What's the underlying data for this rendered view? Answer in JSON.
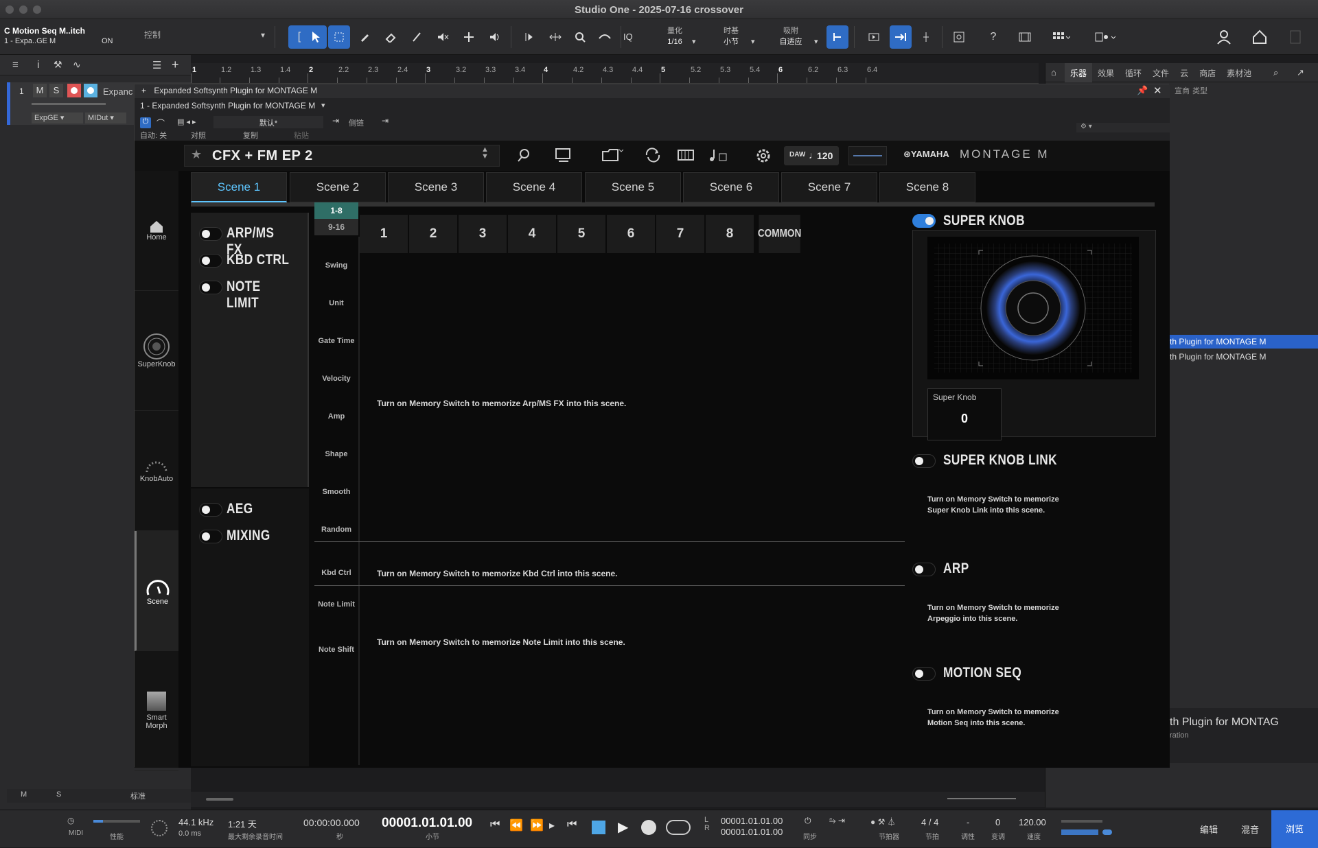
{
  "window": {
    "title": "Studio One - 2025-07-16 crossover"
  },
  "track_header": {
    "name": "C Motion Seq M..itch",
    "sub": "1 - Expa..GE M",
    "label": "控制",
    "on": "ON"
  },
  "toolbar": {
    "quantize_label": "量化",
    "quantize_value": "1/16",
    "timebase_label": "时基",
    "timebase_value": "小节",
    "snap_label": "吸附",
    "snap_value": "自适应",
    "iq": "IQ"
  },
  "ruler": {
    "marks": [
      "1",
      "1.2",
      "1.3",
      "1.4",
      "2",
      "2.2",
      "2.3",
      "2.4",
      "3",
      "3.2",
      "3.3",
      "3.4",
      "4",
      "4.2",
      "4.3",
      "4.4",
      "5",
      "5.2",
      "5.3",
      "5.4",
      "6",
      "6.2",
      "6.3",
      "6.4"
    ]
  },
  "track": {
    "number": "1",
    "m": "M",
    "s": "S",
    "name": "Expanc",
    "input": "ExpGE",
    "output": "MIDut"
  },
  "browser": {
    "tabs": [
      "乐器",
      "效果",
      "循环",
      "文件",
      "云",
      "商店",
      "素材池"
    ],
    "col_a": "宣商",
    "col_b": "类型",
    "items": [
      "th Plugin for MONTAGE M",
      "th Plugin for MONTAGE M"
    ],
    "footer_title": "th Plugin for MONTAG",
    "footer_sub": "ration"
  },
  "plugin": {
    "title": "Expanded Softsynth Plugin for MONTAGE M",
    "instance": "1 - Expanded Softsynth Plugin for MONTAGE M",
    "auto": "自动: 关",
    "compare": "对照",
    "copy": "复制",
    "paste": "粘贴",
    "preset": "默认*",
    "sidechain": "侧链"
  },
  "ym": {
    "preset_name": "CFX + FM EP 2",
    "daw": "DAW",
    "tempo": "120",
    "brand": "YAMAHA",
    "product": "MONTAGE M",
    "side": [
      "Home",
      "SuperKnob",
      "KnobAuto",
      "Scene",
      "Smart Morph"
    ],
    "scenes": [
      "Scene 1",
      "Scene 2",
      "Scene 3",
      "Scene 4",
      "Scene 5",
      "Scene 6",
      "Scene 7",
      "Scene 8"
    ],
    "left_switches_a": [
      "ARP/MS FX",
      "KBD CTRL",
      "NOTE LIMIT"
    ],
    "left_switches_b": [
      "AEG",
      "MIXING"
    ],
    "part_groups": [
      "1-8",
      "9-16"
    ],
    "columns": [
      "1",
      "2",
      "3",
      "4",
      "5",
      "6",
      "7",
      "8",
      "COMMON"
    ],
    "rows": [
      "Swing",
      "Unit",
      "Gate Time",
      "Velocity",
      "Amp",
      "Shape",
      "Smooth",
      "Random"
    ],
    "row_kbd": "Kbd Ctrl",
    "row_note_limit": "Note Limit",
    "row_note_shift": "Note Shift",
    "msg_arp": "Turn on Memory Switch to memorize Arp/MS FX into this scene.",
    "msg_kbd": "Turn on Memory Switch to memorize Kbd Ctrl into this scene.",
    "msg_note": "Turn on Memory Switch to memorize Note Limit into this scene.",
    "super_knob": "SUPER KNOB",
    "super_knob_label": "Super Knob",
    "super_knob_value": "0",
    "super_knob_link": "SUPER KNOB LINK",
    "msg_link_1": "Turn on Memory Switch to memorize",
    "msg_link_2": "Super Knob Link into this scene.",
    "arp": "ARP",
    "msg_arp2_1": "Turn on Memory Switch to memorize",
    "msg_arp2_2": "Arpeggio into this scene.",
    "motion_seq": "MOTION SEQ",
    "msg_ms_1": "Turn on Memory Switch to memorize",
    "msg_ms_2": "Motion Seq into this scene."
  },
  "transport": {
    "midi": "MIDI",
    "perf": "性能",
    "sample_rate": "44.1 kHz",
    "latency": "0.0 ms",
    "record_time": "1:21 天",
    "record_sub": "最大剩余录音时间",
    "time": "00:00:00.000",
    "time_unit": "秒",
    "position": "00001.01.01.00",
    "position_unit": "小节",
    "loop_l": "00001.01.01.00",
    "loop_r": "00001.01.01.00",
    "sync": "同步",
    "metronome": "节拍器",
    "signature": "4 / 4",
    "sig_label": "节拍",
    "key": "-",
    "key_label": "调性",
    "transpose": "0",
    "transpose_label": "变调",
    "tempo": "120.00",
    "tempo_label": "速度",
    "edit": "编辑",
    "mix": "混音",
    "browse": "浏览",
    "lane_m": "M",
    "lane_s": "S",
    "lane_std": "标准"
  }
}
